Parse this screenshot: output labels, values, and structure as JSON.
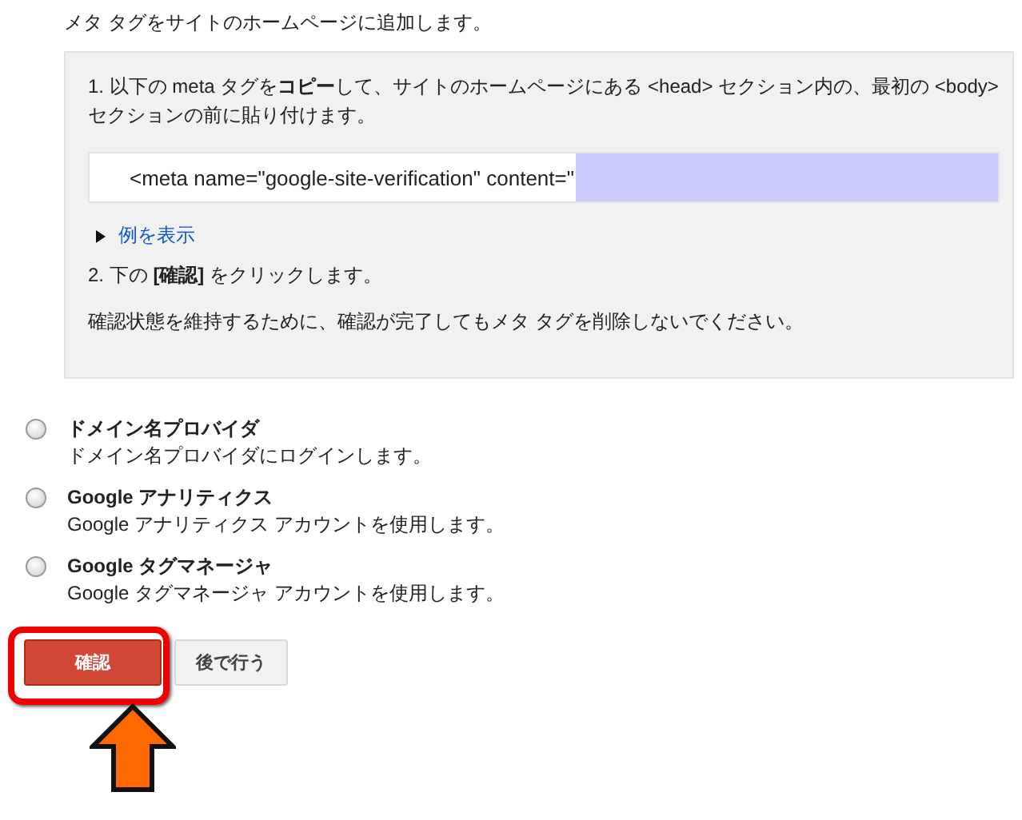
{
  "intro": "メタ タグをサイトのホームページに追加します。",
  "instructions": {
    "step1": "1. 以下の meta タグを**コピー**して、サイトのホームページにある <head> セクション内の、最初の <body> セクションの前に貼り付けます。",
    "code": "<meta name=\"google-site-verification\" content=\"",
    "example_link": "例を表示",
    "step2": "2. 下の **[確認]** をクリックします。",
    "note": "確認状態を維持するために、確認が完了してもメタ タグを削除しないでください。"
  },
  "methods": [
    {
      "title": "ドメイン名プロバイダ",
      "description": "ドメイン名プロバイダにログインします。",
      "selected": false
    },
    {
      "title": "Google アナリティクス",
      "description": "Google アナリティクス アカウントを使用します。",
      "selected": false
    },
    {
      "title": "Google タグマネージャ",
      "description": "Google タグマネージャ アカウントを使用します。",
      "selected": false
    }
  ],
  "buttons": [
    {
      "label": "確認",
      "kind": "primary",
      "highlighted": true
    },
    {
      "label": "後で行う",
      "kind": "secondary",
      "highlighted": false
    }
  ]
}
